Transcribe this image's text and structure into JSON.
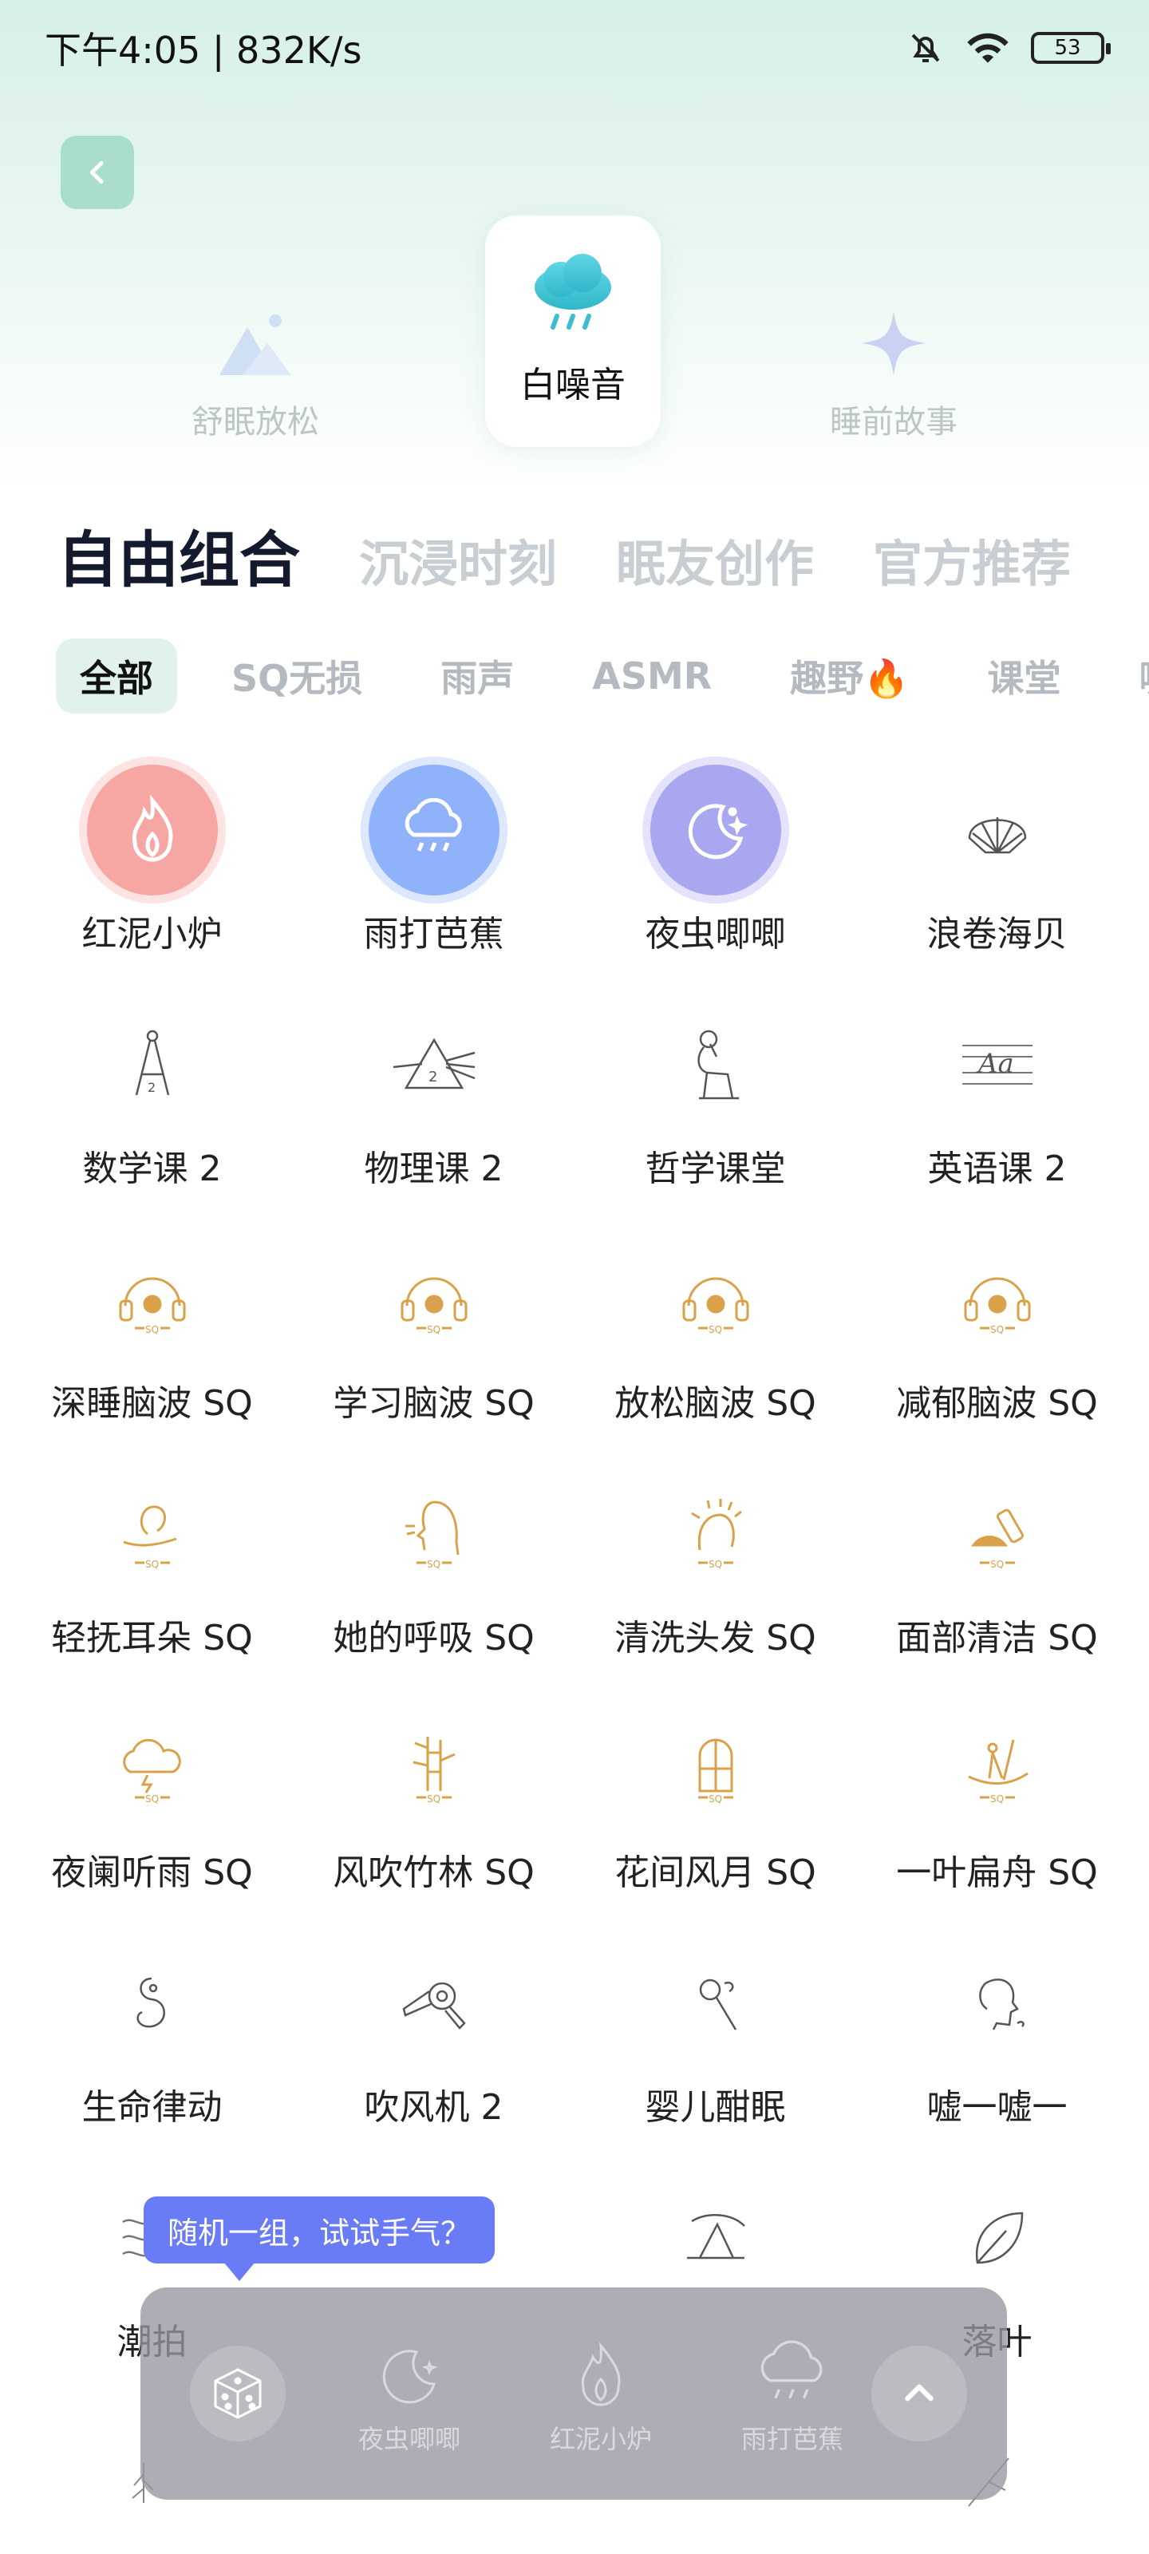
{
  "status_bar": {
    "time": "下午4:05 | 832K/s",
    "battery": "53"
  },
  "categories": [
    {
      "label": "舒眠放松",
      "icon": "mountain-icon"
    },
    {
      "label": "白噪音",
      "icon": "rain-cloud-icon"
    },
    {
      "label": "睡前故事",
      "icon": "star-icon"
    }
  ],
  "main_tabs": [
    "自由组合",
    "沉浸时刻",
    "眠友创作",
    "官方推荐"
  ],
  "chips": [
    "全部",
    "SQ无损",
    "雨声",
    "ASMR",
    "趣野🔥",
    "课堂",
    "咖啡馆"
  ],
  "sounds": [
    {
      "label": "红泥小炉",
      "icon": "flame-icon"
    },
    {
      "label": "雨打芭蕉",
      "icon": "rain-cloud-icon"
    },
    {
      "label": "夜虫唧唧",
      "icon": "moon-icon"
    },
    {
      "label": "浪卷海贝",
      "icon": "shell-icon"
    },
    {
      "label": "数学课 2",
      "icon": "compass-icon"
    },
    {
      "label": "物理课 2",
      "icon": "prism-icon"
    },
    {
      "label": "哲学课堂",
      "icon": "thinker-icon"
    },
    {
      "label": "英语课 2",
      "icon": "letters-icon"
    },
    {
      "label": "深睡脑波 SQ",
      "icon": "headphones-icon"
    },
    {
      "label": "学习脑波 SQ",
      "icon": "headphones-icon"
    },
    {
      "label": "放松脑波 SQ",
      "icon": "headphones-icon"
    },
    {
      "label": "减郁脑波 SQ",
      "icon": "headphones-icon"
    },
    {
      "label": "轻抚耳朵 SQ",
      "icon": "ear-hand-icon"
    },
    {
      "label": "她的呼吸 SQ",
      "icon": "woman-face-icon"
    },
    {
      "label": "清洗头发 SQ",
      "icon": "hair-wash-icon"
    },
    {
      "label": "面部清洁 SQ",
      "icon": "cleanser-icon"
    },
    {
      "label": "夜阑听雨 SQ",
      "icon": "storm-cloud-icon"
    },
    {
      "label": "风吹竹林 SQ",
      "icon": "bamboo-icon"
    },
    {
      "label": "花间风月 SQ",
      "icon": "window-icon"
    },
    {
      "label": "一叶扁舟 SQ",
      "icon": "boat-icon"
    },
    {
      "label": "生命律动",
      "icon": "fetus-icon"
    },
    {
      "label": "吹风机 2",
      "icon": "hair-dryer-icon"
    },
    {
      "label": "婴儿酣眠",
      "icon": "rattle-icon"
    },
    {
      "label": "嘘一嘘一",
      "icon": "face-shush-icon"
    },
    {
      "label": "潮拍",
      "icon": "waves-icon"
    },
    {
      "label": "",
      "icon": "blank"
    },
    {
      "label": "",
      "icon": "tent-icon"
    },
    {
      "label": "落叶",
      "icon": "leaf-icon"
    }
  ],
  "tooltip": "随机一组，试试手气？",
  "dock": {
    "items": [
      {
        "label": "夜虫唧唧",
        "icon": "moon-icon"
      },
      {
        "label": "红泥小炉",
        "icon": "flame-icon"
      },
      {
        "label": "雨打芭蕉",
        "icon": "rain-cloud-icon"
      }
    ]
  },
  "colors": {
    "accent_gold": "#d9a24a",
    "tooltip_bg": "#6a7cf5",
    "chip_active_bg": "#e1f2ec",
    "flame_circle": "#f6a7a4",
    "rain_circle": "#8fb2fb",
    "moon_circle": "#a9a7f0"
  }
}
